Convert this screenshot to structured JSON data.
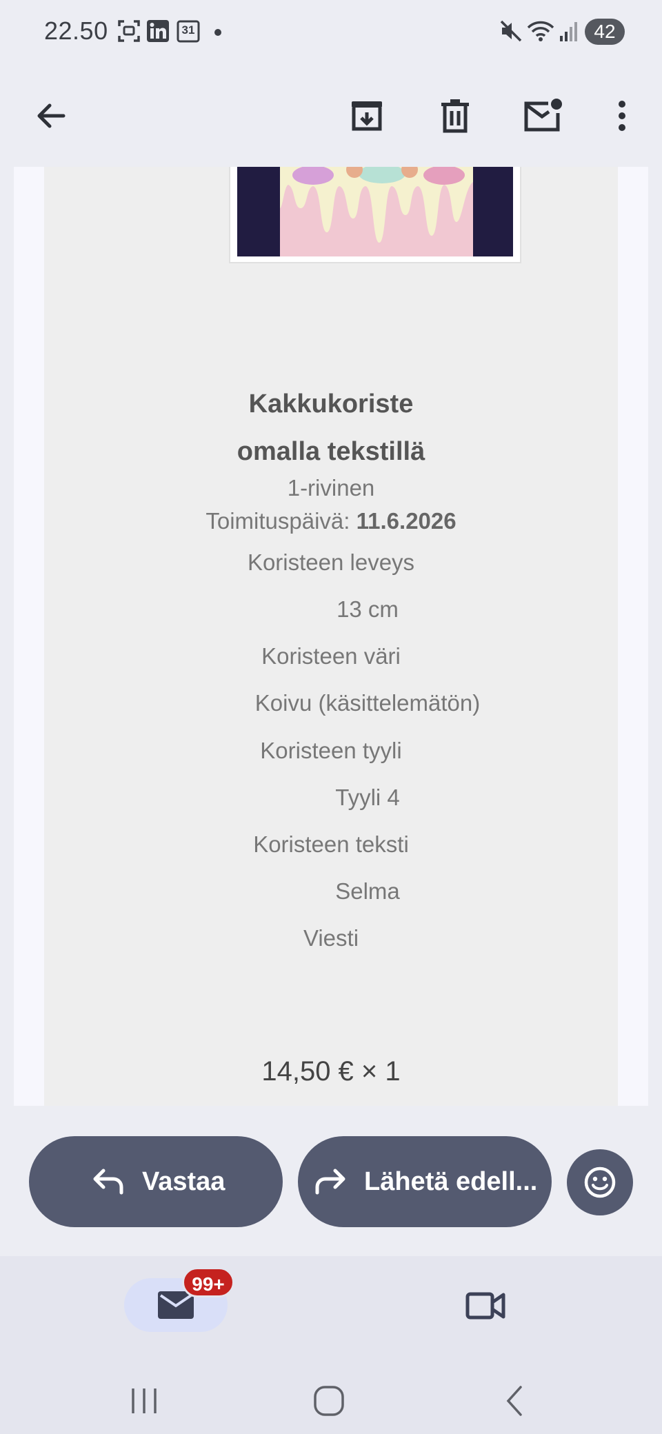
{
  "status_bar": {
    "time": "22.50",
    "battery": "42",
    "icons": [
      "screenshot-icon",
      "linkedin-icon",
      "calendar-icon",
      "dot-icon",
      "mute-icon",
      "wifi-icon",
      "signal-icon"
    ],
    "calendar_day": "31"
  },
  "app_bar": {
    "icons": [
      "back-arrow-icon",
      "archive-icon",
      "delete-icon",
      "mark-unread-icon",
      "more-vert-icon"
    ]
  },
  "email": {
    "product_title": "Kakkukoriste omalla tekstillä",
    "variant": "1-rivinen",
    "delivery_label": "Toimituspäivä: ",
    "delivery_date": "11.6.2026",
    "width_label": "Koristeen leveys",
    "width_value": "13 cm",
    "color_label": "Koristeen väri",
    "color_value": "Koivu (käsittelemätön)",
    "style_label": "Koristeen tyyli",
    "style_value": "Tyyli 4",
    "text_label": "Koristeen teksti",
    "text_value": "Selma",
    "message_label": "Viesti",
    "price": "14,50 € × 1"
  },
  "actions": {
    "reply_label": "Vastaa",
    "forward_label": "Lähetä edell...",
    "emoji_icon": "smiley-icon"
  },
  "bottom_nav": {
    "mail_badge": "99+",
    "icons": [
      "mail-icon",
      "video-icon"
    ]
  },
  "system_nav": {
    "icons": [
      "recent-apps-icon",
      "home-icon",
      "back-icon"
    ]
  },
  "colors": {
    "background": "#ecedf3",
    "email_body": "#eeeeee",
    "action_button": "#545a70",
    "badge": "#c5221f",
    "mail_pill": "#d9dff8"
  }
}
